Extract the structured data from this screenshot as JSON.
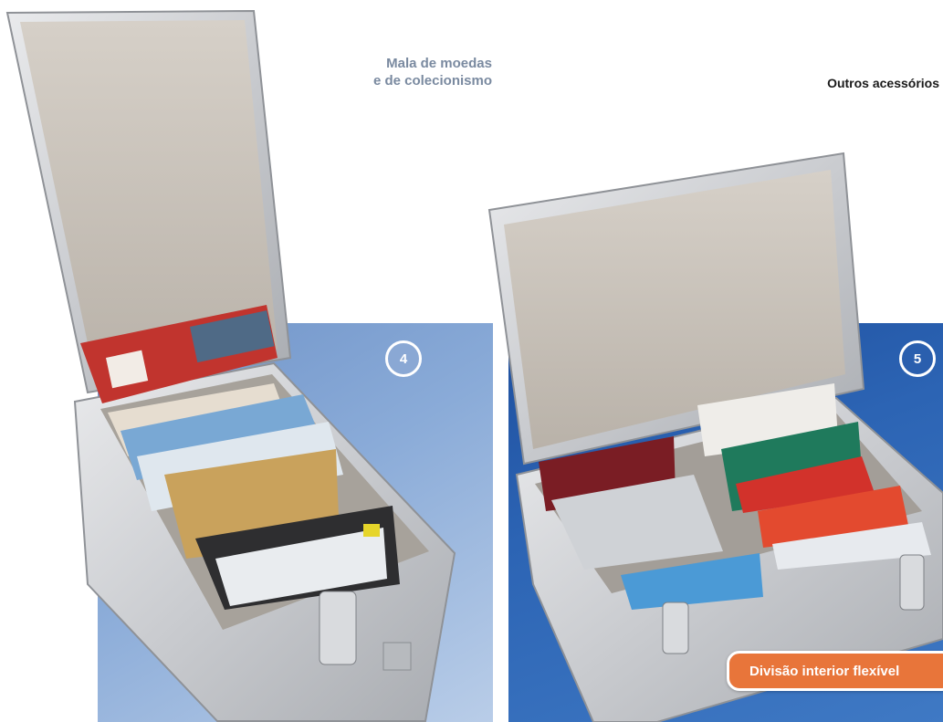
{
  "header": {
    "subtitle_line1": "Mala de moedas",
    "subtitle_line2": "e de colecionismo",
    "section_title": "Outros acessórios"
  },
  "products": [
    {
      "number": "4"
    },
    {
      "number": "5"
    }
  ],
  "feature_label": "Divisão interior flexível",
  "colors": {
    "panel_left": "#8aabd8",
    "panel_right": "#2c64b4",
    "accent_orange": "#e8753a",
    "subtitle_gray": "#7a8aa0"
  }
}
